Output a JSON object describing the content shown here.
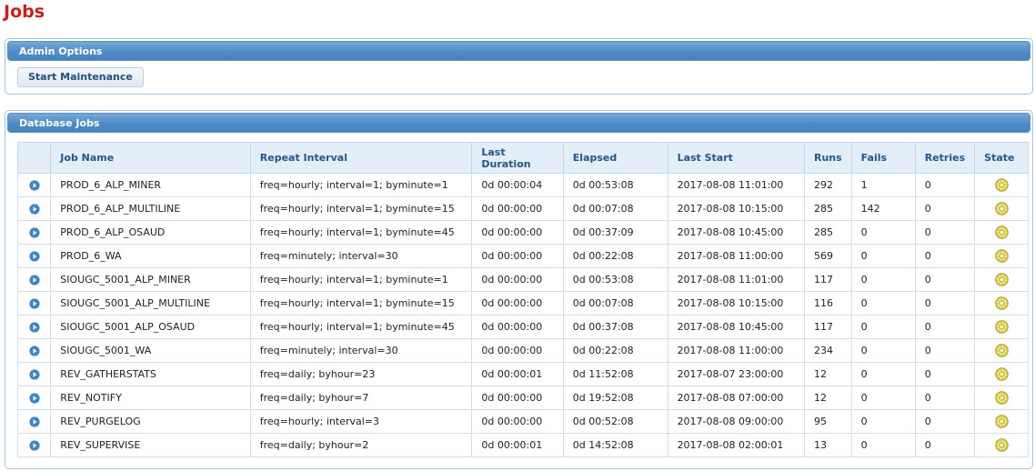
{
  "page": {
    "title": "Jobs"
  },
  "admin_panel": {
    "title": "Admin Options",
    "start_maintenance_label": "Start Maintenance"
  },
  "jobs_panel": {
    "title": "Database Jobs",
    "columns": {
      "job_name": "Job Name",
      "repeat_interval": "Repeat Interval",
      "last_duration": "Last Duration",
      "elapsed": "Elapsed",
      "last_start": "Last Start",
      "runs": "Runs",
      "fails": "Fails",
      "retries": "Retries",
      "state": "State"
    },
    "rows": [
      {
        "name": "PROD_6_ALP_MINER",
        "interval": "freq=hourly; interval=1; byminute=1",
        "last_duration": "0d 00:00:04",
        "elapsed": "0d 00:53:08",
        "last_start": "2017-08-08 11:01:00",
        "runs": "292",
        "fails": "1",
        "retries": "0"
      },
      {
        "name": "PROD_6_ALP_MULTILINE",
        "interval": "freq=hourly; interval=1; byminute=15",
        "last_duration": "0d 00:00:00",
        "elapsed": "0d 00:07:08",
        "last_start": "2017-08-08 10:15:00",
        "runs": "285",
        "fails": "142",
        "retries": "0"
      },
      {
        "name": "PROD_6_ALP_OSAUD",
        "interval": "freq=hourly; interval=1; byminute=45",
        "last_duration": "0d 00:00:00",
        "elapsed": "0d 00:37:09",
        "last_start": "2017-08-08 10:45:00",
        "runs": "285",
        "fails": "0",
        "retries": "0"
      },
      {
        "name": "PROD_6_WA",
        "interval": "freq=minutely; interval=30",
        "last_duration": "0d 00:00:00",
        "elapsed": "0d 00:22:08",
        "last_start": "2017-08-08 11:00:00",
        "runs": "569",
        "fails": "0",
        "retries": "0"
      },
      {
        "name": "SIOUGC_5001_ALP_MINER",
        "interval": "freq=hourly; interval=1; byminute=1",
        "last_duration": "0d 00:00:00",
        "elapsed": "0d 00:53:08",
        "last_start": "2017-08-08 11:01:00",
        "runs": "117",
        "fails": "0",
        "retries": "0"
      },
      {
        "name": "SIOUGC_5001_ALP_MULTILINE",
        "interval": "freq=hourly; interval=1; byminute=15",
        "last_duration": "0d 00:00:00",
        "elapsed": "0d 00:07:08",
        "last_start": "2017-08-08 10:15:00",
        "runs": "116",
        "fails": "0",
        "retries": "0"
      },
      {
        "name": "SIOUGC_5001_ALP_OSAUD",
        "interval": "freq=hourly; interval=1; byminute=45",
        "last_duration": "0d 00:00:00",
        "elapsed": "0d 00:37:08",
        "last_start": "2017-08-08 10:45:00",
        "runs": "117",
        "fails": "0",
        "retries": "0"
      },
      {
        "name": "SIOUGC_5001_WA",
        "interval": "freq=minutely; interval=30",
        "last_duration": "0d 00:00:00",
        "elapsed": "0d 00:22:08",
        "last_start": "2017-08-08 11:00:00",
        "runs": "234",
        "fails": "0",
        "retries": "0"
      },
      {
        "name": "REV_GATHERSTATS",
        "interval": "freq=daily; byhour=23",
        "last_duration": "0d 00:00:01",
        "elapsed": "0d 11:52:08",
        "last_start": "2017-08-07 23:00:00",
        "runs": "12",
        "fails": "0",
        "retries": "0"
      },
      {
        "name": "REV_NOTIFY",
        "interval": "freq=daily; byhour=7",
        "last_duration": "0d 00:00:00",
        "elapsed": "0d 19:52:08",
        "last_start": "2017-08-08 07:00:00",
        "runs": "12",
        "fails": "0",
        "retries": "0"
      },
      {
        "name": "REV_PURGELOG",
        "interval": "freq=hourly; interval=3",
        "last_duration": "0d 00:00:00",
        "elapsed": "0d 00:52:08",
        "last_start": "2017-08-08 09:00:00",
        "runs": "95",
        "fails": "0",
        "retries": "0"
      },
      {
        "name": "REV_SUPERVISE",
        "interval": "freq=daily; byhour=2",
        "last_duration": "0d 00:00:01",
        "elapsed": "0d 14:52:08",
        "last_start": "2017-08-08 02:00:01",
        "runs": "13",
        "fails": "0",
        "retries": "0"
      }
    ]
  },
  "icons": {
    "row_action": "play-circle-icon",
    "state": "state-status-icon"
  },
  "colors": {
    "title_red": "#c8201e",
    "header_blue": "#4f8bc4",
    "action_blue": "#3d86c9",
    "state_yellow": "#c9b832"
  }
}
